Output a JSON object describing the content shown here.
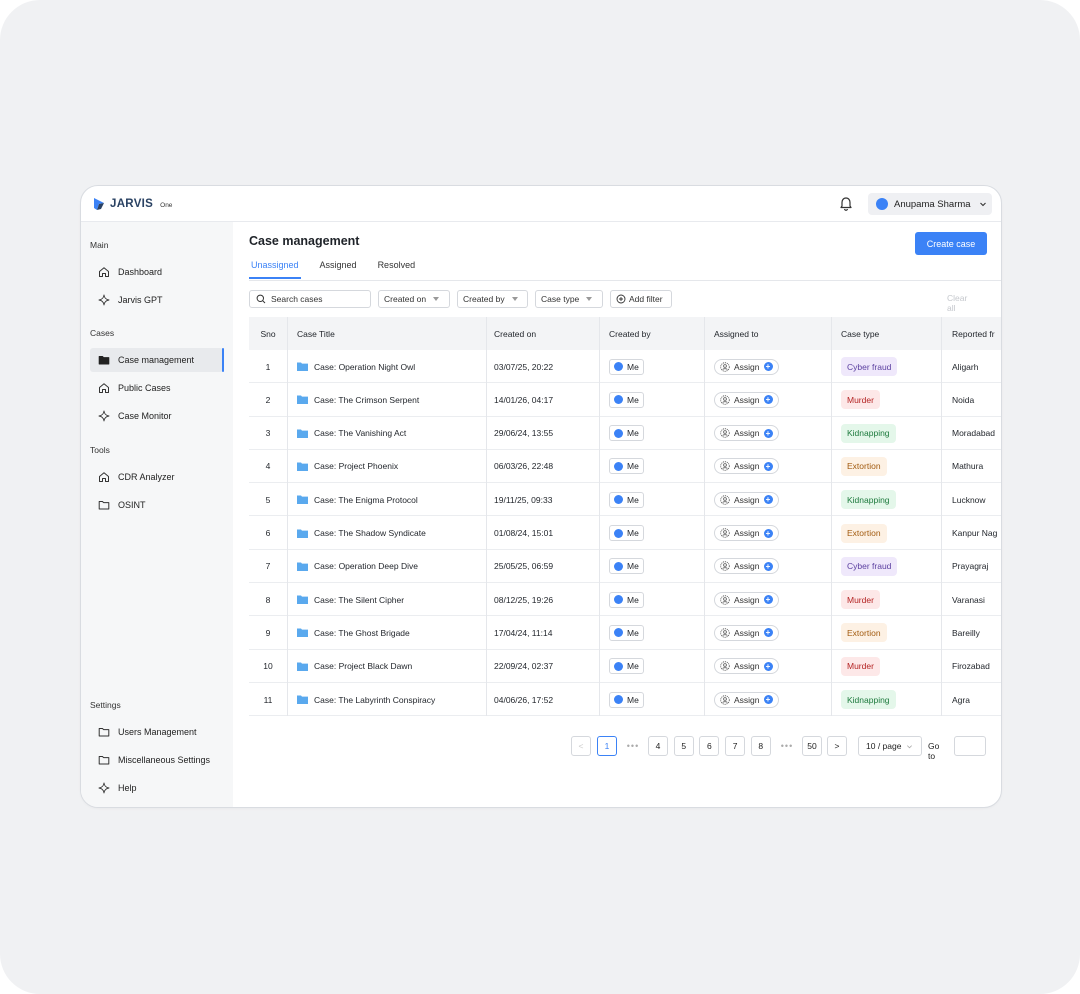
{
  "app": {
    "logo_text": "JARVIS",
    "logo_sub": "One"
  },
  "header": {
    "user_name": "Anupama Sharma"
  },
  "sidebar": {
    "sections": [
      {
        "label": "Main",
        "items": [
          {
            "label": "Dashboard",
            "icon": "home-icon"
          },
          {
            "label": "Jarvis GPT",
            "icon": "sparkle-icon"
          }
        ]
      },
      {
        "label": "Cases",
        "items": [
          {
            "label": "Case management",
            "icon": "folder-filled-icon",
            "active": true
          },
          {
            "label": "Public Cases",
            "icon": "home-icon"
          },
          {
            "label": "Case Monitor",
            "icon": "sparkle-icon"
          }
        ]
      },
      {
        "label": "Tools",
        "items": [
          {
            "label": "CDR Analyzer",
            "icon": "home-icon"
          },
          {
            "label": "OSINT",
            "icon": "folder-icon"
          }
        ]
      },
      {
        "label": "Settings",
        "items": [
          {
            "label": "Users Management",
            "icon": "folder-icon"
          },
          {
            "label": "Miscellaneous Settings",
            "icon": "folder-icon"
          },
          {
            "label": "Help",
            "icon": "sparkle-icon"
          }
        ]
      }
    ]
  },
  "main": {
    "title": "Case management",
    "create_button": "Create case",
    "tabs": [
      {
        "label": "Unassigned",
        "active": true
      },
      {
        "label": "Assigned"
      },
      {
        "label": "Resolved"
      }
    ],
    "filters": {
      "search_placeholder": "Search cases",
      "buttons": [
        "Created on",
        "Created by",
        "Case type"
      ],
      "add_filter": "Add filter",
      "clear_all": "Clear all"
    }
  },
  "table": {
    "columns": [
      "Sno",
      "Case Title",
      "Created on",
      "Created by",
      "Assigned to",
      "Case type",
      "Reported fr"
    ],
    "me_label": "Me",
    "assign_label": "Assign",
    "rows": [
      {
        "sno": "1",
        "title": "Case: Operation Night Owl",
        "created_on": "03/07/25, 20:22",
        "case_type": "Cyber fraud",
        "reported": "Aligarh"
      },
      {
        "sno": "2",
        "title": "Case: The Crimson Serpent",
        "created_on": "14/01/26, 04:17",
        "case_type": "Murder",
        "reported": "Noida"
      },
      {
        "sno": "3",
        "title": "Case: The Vanishing Act",
        "created_on": "29/06/24, 13:55",
        "case_type": "Kidnapping",
        "reported": "Moradabad"
      },
      {
        "sno": "4",
        "title": "Case: Project Phoenix",
        "created_on": "06/03/26, 22:48",
        "case_type": "Extortion",
        "reported": "Mathura"
      },
      {
        "sno": "5",
        "title": "Case: The Enigma Protocol",
        "created_on": "19/11/25, 09:33",
        "case_type": "Kidnapping",
        "reported": "Lucknow"
      },
      {
        "sno": "6",
        "title": "Case: The Shadow Syndicate",
        "created_on": "01/08/24, 15:01",
        "case_type": "Extortion",
        "reported": "Kanpur Nag"
      },
      {
        "sno": "7",
        "title": "Case: Operation Deep Dive",
        "created_on": "25/05/25, 06:59",
        "case_type": "Cyber fraud",
        "reported": "Prayagraj"
      },
      {
        "sno": "8",
        "title": "Case: The Silent Cipher",
        "created_on": "08/12/25, 19:26",
        "case_type": "Murder",
        "reported": "Varanasi"
      },
      {
        "sno": "9",
        "title": "Case: The Ghost Brigade",
        "created_on": "17/04/24, 11:14",
        "case_type": "Extortion",
        "reported": "Bareilly"
      },
      {
        "sno": "10",
        "title": "Case: Project Black Dawn",
        "created_on": "22/09/24, 02:37",
        "case_type": "Murder",
        "reported": "Firozabad"
      },
      {
        "sno": "11",
        "title": "Case: The Labyrinth Conspiracy",
        "created_on": "04/06/26, 17:52",
        "case_type": "Kidnapping",
        "reported": "Agra"
      }
    ],
    "tag_colors": {
      "Cyber fraud": {
        "bg": "#efe8fb",
        "fg": "#5b3fa0"
      },
      "Murder": {
        "bg": "#fde8e8",
        "fg": "#b42323"
      },
      "Kidnapping": {
        "bg": "#e4f7ea",
        "fg": "#1d7a3d"
      },
      "Extortion": {
        "bg": "#fdf1e4",
        "fg": "#a25b10"
      }
    }
  },
  "pagination": {
    "prev": "<",
    "next": ">",
    "pages": [
      "1",
      "4",
      "5",
      "6",
      "7",
      "8",
      "50"
    ],
    "current": "1",
    "ellipsis": "•••",
    "page_size": "10 / page",
    "goto_label": "Go to"
  },
  "colors": {
    "accent": "#3b82f6",
    "sidebar_bg": "#f6f7f8",
    "header_bg": "#f3f4f6"
  }
}
